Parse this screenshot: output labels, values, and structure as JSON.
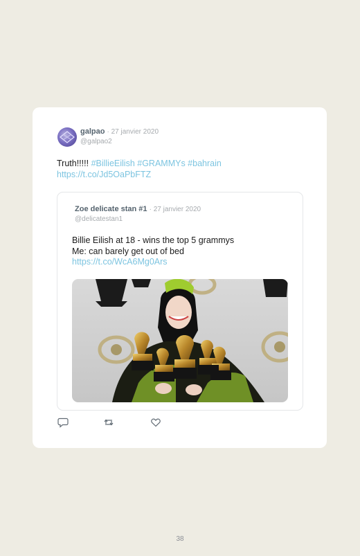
{
  "tweet": {
    "author_name": "galpao",
    "date": "· 27 janvier 2020",
    "handle": "@galpao2",
    "text_plain": "Truth!!!!! ",
    "hashtags": "#BillieEilish #GRAMMYs #bahrain",
    "link": "https://t.co/Jd5OaPbFTZ"
  },
  "quoted": {
    "author_name": "Zoe delicate stan #1",
    "date": "· 27 janvier 2020",
    "handle": "@delicatestan1",
    "line1": "Billie Eilish at 18 - wins the top 5 grammys",
    "line2": "Me: can barely get out of bed",
    "link": "https://t.co/WcA6Mg0Ars"
  },
  "actions": {
    "reply_icon": "reply-icon",
    "retweet_icon": "retweet-icon",
    "like_icon": "heart-icon"
  },
  "page_number": "38"
}
